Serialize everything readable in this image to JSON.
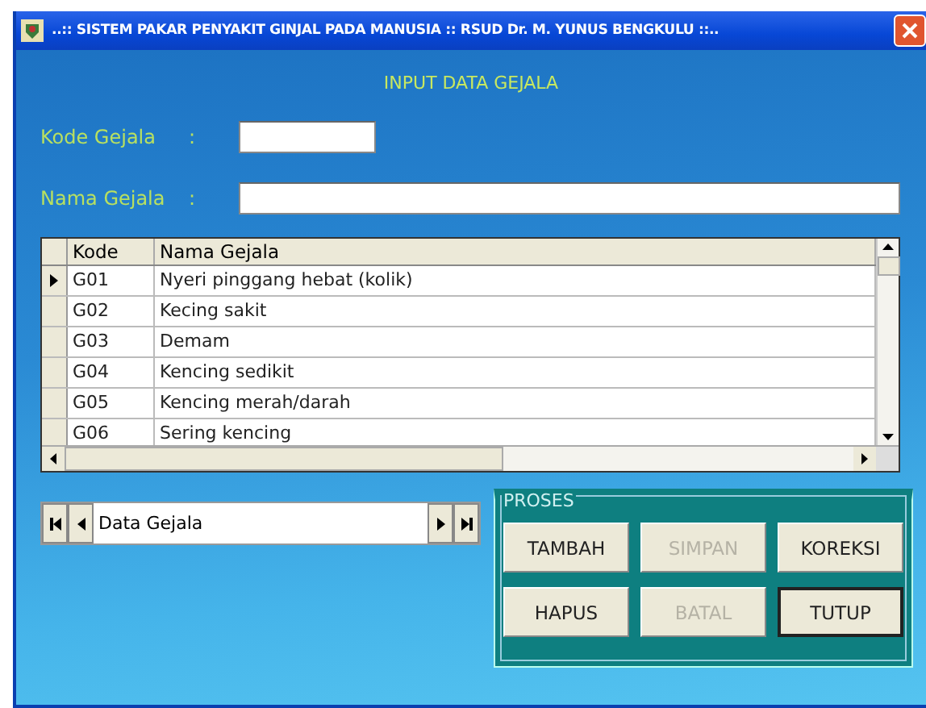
{
  "window": {
    "title": "..:: SISTEM PAKAR PENYAKIT GINJAL PADA MANUSIA :: RSUD Dr. M. YUNUS BENGKULU ::.."
  },
  "heading": "INPUT DATA GEJALA",
  "fields": [
    {
      "label": "Kode Gejala",
      "colon": ":"
    },
    {
      "label": "Nama Gejala",
      "colon": ":"
    }
  ],
  "table": {
    "columns": [
      "Kode",
      "Nama Gejala"
    ],
    "rows": [
      {
        "cells": [
          "G01",
          "Nyeri pinggang hebat (kolik)"
        ],
        "selected": true
      },
      {
        "cells": [
          "G02",
          "Kecing sakit"
        ],
        "selected": false
      },
      {
        "cells": [
          "G03",
          "Demam"
        ],
        "selected": false
      },
      {
        "cells": [
          "G04",
          "Kencing sedikit"
        ],
        "selected": false
      },
      {
        "cells": [
          "G05",
          "Kencing merah/darah"
        ],
        "selected": false
      },
      {
        "cells": [
          "G06",
          "Sering kencing"
        ],
        "selected": false
      }
    ]
  },
  "navigator": {
    "caption": "Data Gejala"
  },
  "proses": {
    "title": "PROSES",
    "buttons": [
      {
        "label": "TAMBAH",
        "disabled": false,
        "focused": false
      },
      {
        "label": "SIMPAN",
        "disabled": true,
        "focused": false
      },
      {
        "label": "KOREKSI",
        "disabled": false,
        "focused": false
      },
      {
        "label": "HAPUS",
        "disabled": false,
        "focused": false
      },
      {
        "label": "BATAL",
        "disabled": true,
        "focused": false
      },
      {
        "label": "TUTUP",
        "disabled": false,
        "focused": true
      }
    ]
  }
}
